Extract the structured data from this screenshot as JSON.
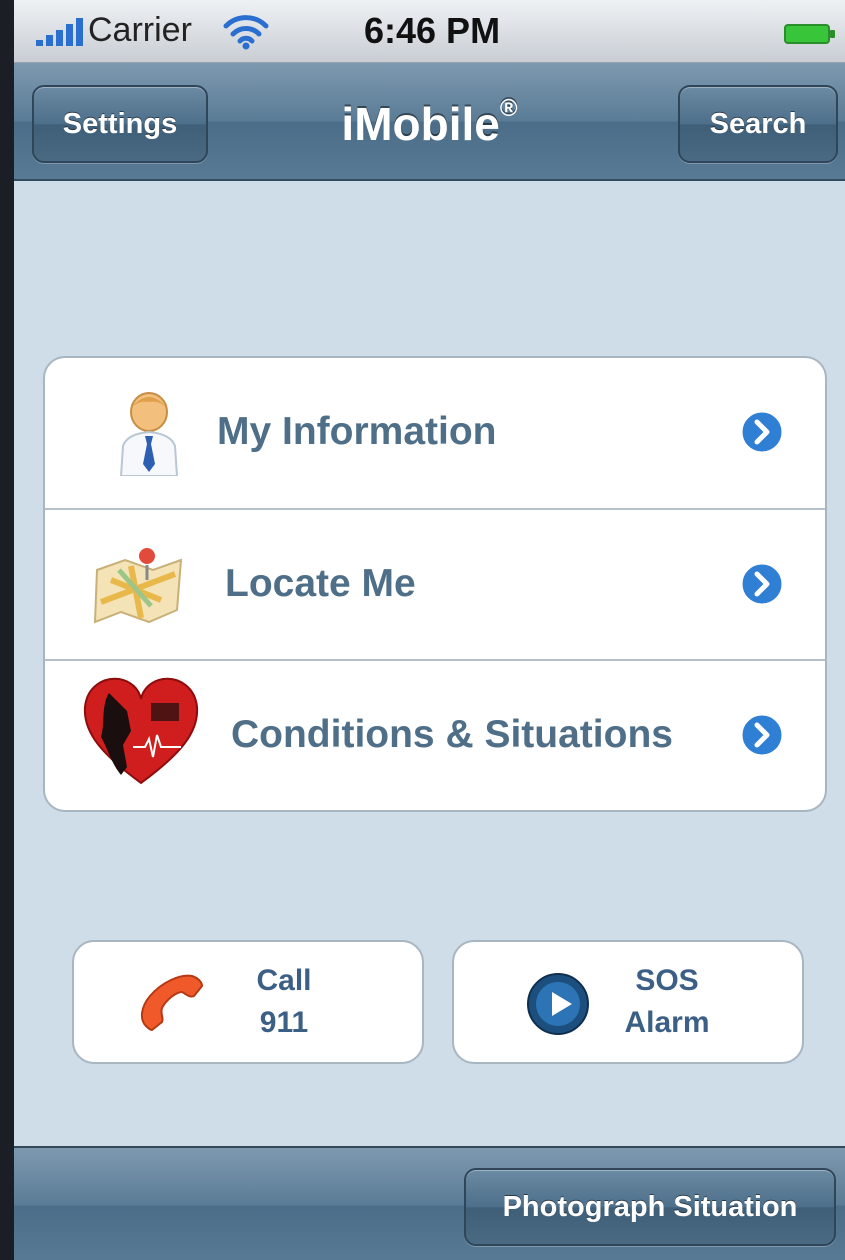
{
  "status_bar": {
    "carrier": "Carrier",
    "time": "6:46 PM"
  },
  "nav_bar": {
    "left_button": "Settings",
    "title": "iMobile",
    "title_mark": "®",
    "right_button": "Search"
  },
  "menu": {
    "items": [
      {
        "label": "My Information",
        "icon": "user-icon"
      },
      {
        "label": "Locate Me",
        "icon": "map-icon"
      },
      {
        "label": "Conditions & Situations",
        "icon": "heart-icon"
      }
    ]
  },
  "actions": {
    "call": {
      "line1": "Call",
      "line2": "911",
      "icon": "phone-icon"
    },
    "sos": {
      "line1": "SOS",
      "line2": "Alarm",
      "icon": "play-icon"
    }
  },
  "toolbar": {
    "photo_button": "Photograph Situation"
  },
  "colors": {
    "nav_bar": "#5b7c96",
    "background": "#cfdde8",
    "row_label": "#4f6f88",
    "action_label": "#3c5f86",
    "disclosure": "#2f7fd4"
  }
}
